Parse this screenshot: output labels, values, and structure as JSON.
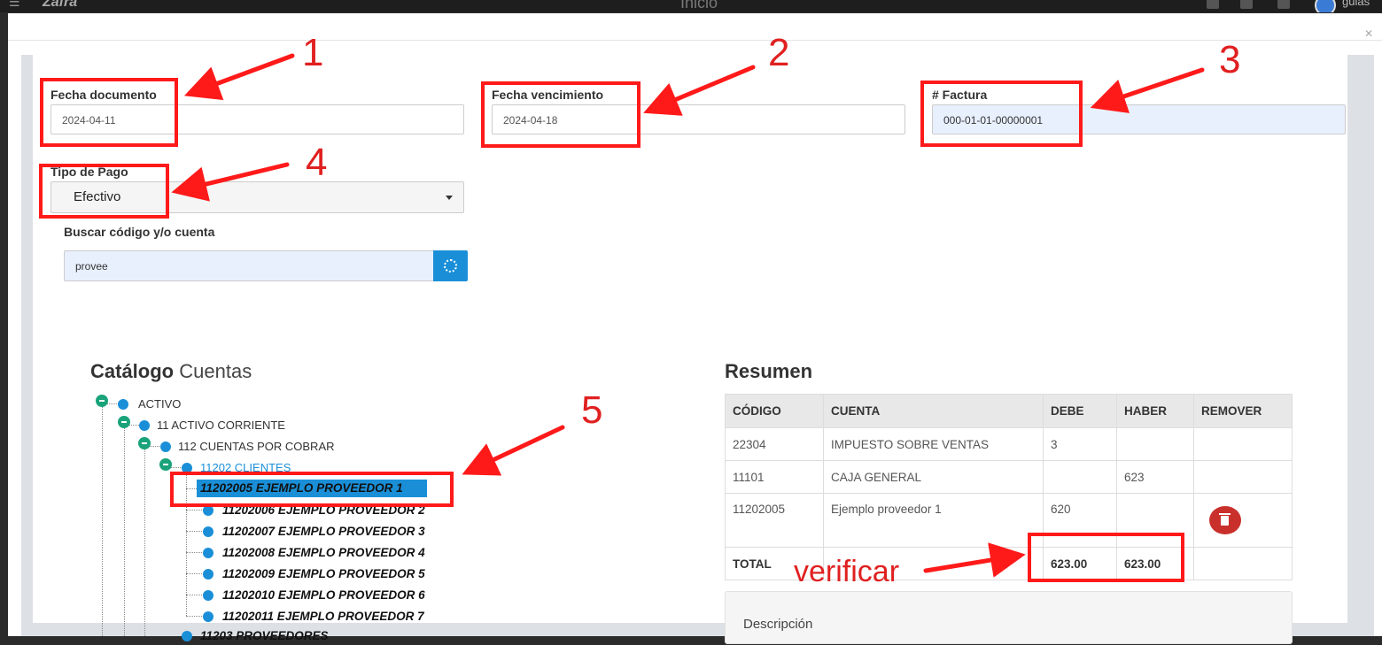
{
  "app": {
    "logo": "Zafra",
    "title": "Inicio",
    "user": "guias"
  },
  "form": {
    "fecha_documento": {
      "label": "Fecha documento",
      "value": "2024-04-11"
    },
    "fecha_vencimiento": {
      "label": "Fecha vencimiento",
      "value": "2024-04-18"
    },
    "factura": {
      "label": "# Factura",
      "value": "000-01-01-00000001"
    },
    "tipo_pago": {
      "label": "Tipo de Pago",
      "value": "Efectivo"
    },
    "buscar": {
      "label": "Buscar código y/o cuenta",
      "value": "provee"
    }
  },
  "catalogo": {
    "title_bold": "Catálogo",
    "title_light": "Cuentas",
    "items": [
      "ACTIVO",
      "11 ACTIVO CORRIENTE",
      "112 CUENTAS POR COBRAR",
      "11202 CLIENTES",
      "11202005 EJEMPLO PROVEEDOR 1",
      "11202006 EJEMPLO PROVEEDOR 2",
      "11202007 EJEMPLO PROVEEDOR 3",
      "11202008 EJEMPLO PROVEEDOR 4",
      "11202009 EJEMPLO PROVEEDOR 5",
      "11202010 EJEMPLO PROVEEDOR 6",
      "11202011 EJEMPLO PROVEEDOR 7",
      "11203 PROVEEDORES"
    ]
  },
  "resumen": {
    "title": "Resumen",
    "headers": [
      "CÓDIGO",
      "CUENTA",
      "DEBE",
      "HABER",
      "REMOVER"
    ],
    "rows": [
      [
        "22304",
        "IMPUESTO SOBRE VENTAS",
        "3",
        ""
      ],
      [
        "11101",
        "CAJA GENERAL",
        "",
        "623"
      ],
      [
        "11202005",
        "Ejemplo proveedor 1",
        "620",
        ""
      ]
    ],
    "total": {
      "label": "TOTAL",
      "debe": "623.00",
      "haber": "623.00"
    },
    "descripcion_label": "Descripción"
  },
  "annotations": {
    "numbers": [
      "1",
      "2",
      "3",
      "4",
      "5"
    ],
    "verificar": "verificar",
    "color": "#ff1a1a"
  }
}
